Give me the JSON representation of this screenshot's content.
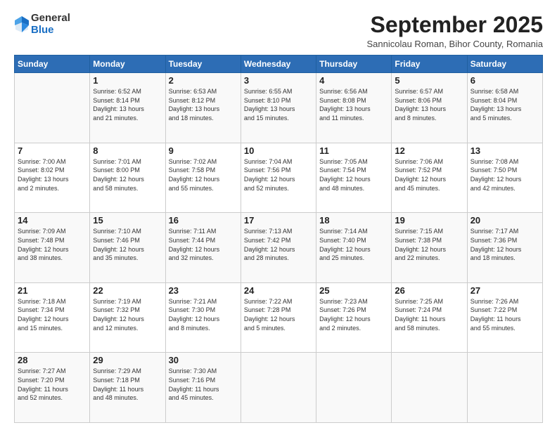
{
  "header": {
    "logo": {
      "line1": "General",
      "line2": "Blue"
    },
    "title": "September 2025",
    "subtitle": "Sannicolau Roman, Bihor County, Romania"
  },
  "days_of_week": [
    "Sunday",
    "Monday",
    "Tuesday",
    "Wednesday",
    "Thursday",
    "Friday",
    "Saturday"
  ],
  "weeks": [
    [
      {
        "day": "",
        "info": ""
      },
      {
        "day": "1",
        "info": "Sunrise: 6:52 AM\nSunset: 8:14 PM\nDaylight: 13 hours\nand 21 minutes."
      },
      {
        "day": "2",
        "info": "Sunrise: 6:53 AM\nSunset: 8:12 PM\nDaylight: 13 hours\nand 18 minutes."
      },
      {
        "day": "3",
        "info": "Sunrise: 6:55 AM\nSunset: 8:10 PM\nDaylight: 13 hours\nand 15 minutes."
      },
      {
        "day": "4",
        "info": "Sunrise: 6:56 AM\nSunset: 8:08 PM\nDaylight: 13 hours\nand 11 minutes."
      },
      {
        "day": "5",
        "info": "Sunrise: 6:57 AM\nSunset: 8:06 PM\nDaylight: 13 hours\nand 8 minutes."
      },
      {
        "day": "6",
        "info": "Sunrise: 6:58 AM\nSunset: 8:04 PM\nDaylight: 13 hours\nand 5 minutes."
      }
    ],
    [
      {
        "day": "7",
        "info": "Sunrise: 7:00 AM\nSunset: 8:02 PM\nDaylight: 13 hours\nand 2 minutes."
      },
      {
        "day": "8",
        "info": "Sunrise: 7:01 AM\nSunset: 8:00 PM\nDaylight: 12 hours\nand 58 minutes."
      },
      {
        "day": "9",
        "info": "Sunrise: 7:02 AM\nSunset: 7:58 PM\nDaylight: 12 hours\nand 55 minutes."
      },
      {
        "day": "10",
        "info": "Sunrise: 7:04 AM\nSunset: 7:56 PM\nDaylight: 12 hours\nand 52 minutes."
      },
      {
        "day": "11",
        "info": "Sunrise: 7:05 AM\nSunset: 7:54 PM\nDaylight: 12 hours\nand 48 minutes."
      },
      {
        "day": "12",
        "info": "Sunrise: 7:06 AM\nSunset: 7:52 PM\nDaylight: 12 hours\nand 45 minutes."
      },
      {
        "day": "13",
        "info": "Sunrise: 7:08 AM\nSunset: 7:50 PM\nDaylight: 12 hours\nand 42 minutes."
      }
    ],
    [
      {
        "day": "14",
        "info": "Sunrise: 7:09 AM\nSunset: 7:48 PM\nDaylight: 12 hours\nand 38 minutes."
      },
      {
        "day": "15",
        "info": "Sunrise: 7:10 AM\nSunset: 7:46 PM\nDaylight: 12 hours\nand 35 minutes."
      },
      {
        "day": "16",
        "info": "Sunrise: 7:11 AM\nSunset: 7:44 PM\nDaylight: 12 hours\nand 32 minutes."
      },
      {
        "day": "17",
        "info": "Sunrise: 7:13 AM\nSunset: 7:42 PM\nDaylight: 12 hours\nand 28 minutes."
      },
      {
        "day": "18",
        "info": "Sunrise: 7:14 AM\nSunset: 7:40 PM\nDaylight: 12 hours\nand 25 minutes."
      },
      {
        "day": "19",
        "info": "Sunrise: 7:15 AM\nSunset: 7:38 PM\nDaylight: 12 hours\nand 22 minutes."
      },
      {
        "day": "20",
        "info": "Sunrise: 7:17 AM\nSunset: 7:36 PM\nDaylight: 12 hours\nand 18 minutes."
      }
    ],
    [
      {
        "day": "21",
        "info": "Sunrise: 7:18 AM\nSunset: 7:34 PM\nDaylight: 12 hours\nand 15 minutes."
      },
      {
        "day": "22",
        "info": "Sunrise: 7:19 AM\nSunset: 7:32 PM\nDaylight: 12 hours\nand 12 minutes."
      },
      {
        "day": "23",
        "info": "Sunrise: 7:21 AM\nSunset: 7:30 PM\nDaylight: 12 hours\nand 8 minutes."
      },
      {
        "day": "24",
        "info": "Sunrise: 7:22 AM\nSunset: 7:28 PM\nDaylight: 12 hours\nand 5 minutes."
      },
      {
        "day": "25",
        "info": "Sunrise: 7:23 AM\nSunset: 7:26 PM\nDaylight: 12 hours\nand 2 minutes."
      },
      {
        "day": "26",
        "info": "Sunrise: 7:25 AM\nSunset: 7:24 PM\nDaylight: 11 hours\nand 58 minutes."
      },
      {
        "day": "27",
        "info": "Sunrise: 7:26 AM\nSunset: 7:22 PM\nDaylight: 11 hours\nand 55 minutes."
      }
    ],
    [
      {
        "day": "28",
        "info": "Sunrise: 7:27 AM\nSunset: 7:20 PM\nDaylight: 11 hours\nand 52 minutes."
      },
      {
        "day": "29",
        "info": "Sunrise: 7:29 AM\nSunset: 7:18 PM\nDaylight: 11 hours\nand 48 minutes."
      },
      {
        "day": "30",
        "info": "Sunrise: 7:30 AM\nSunset: 7:16 PM\nDaylight: 11 hours\nand 45 minutes."
      },
      {
        "day": "",
        "info": ""
      },
      {
        "day": "",
        "info": ""
      },
      {
        "day": "",
        "info": ""
      },
      {
        "day": "",
        "info": ""
      }
    ]
  ]
}
